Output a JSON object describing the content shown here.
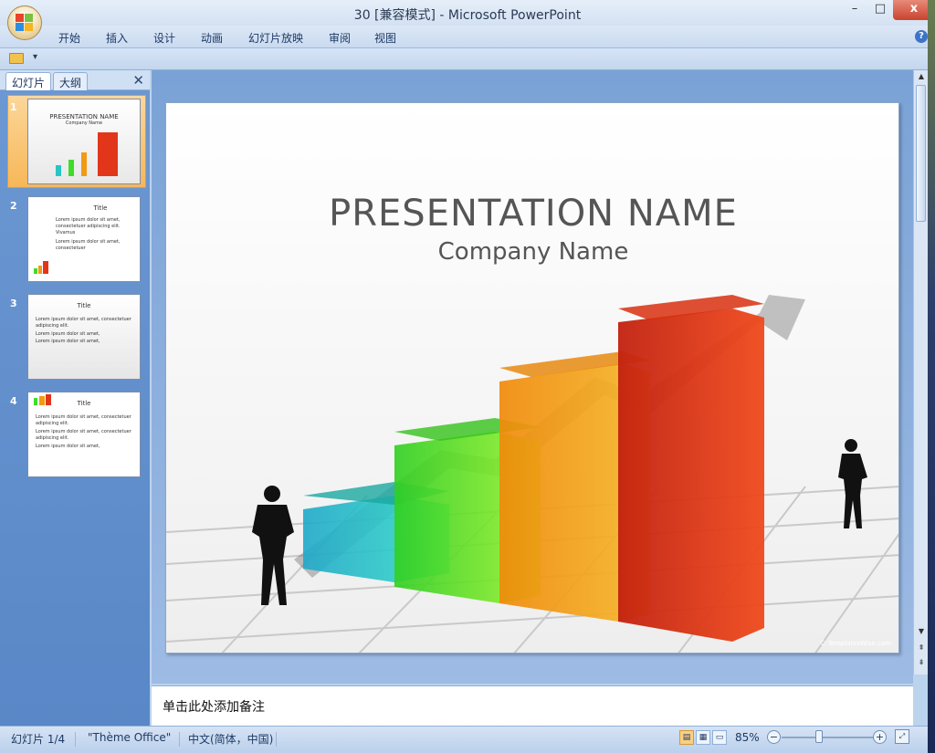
{
  "window": {
    "title": "30 [兼容模式] - Microsoft PowerPoint",
    "minimize": "–",
    "maximize": "□",
    "close": "x"
  },
  "ribbon": {
    "tabs": [
      "开始",
      "插入",
      "设计",
      "动画",
      "幻灯片放映",
      "审阅",
      "视图"
    ],
    "help": "?"
  },
  "left_pane": {
    "tabs": [
      "幻灯片",
      "大纲"
    ],
    "close": "✕",
    "thumbnails": [
      {
        "num": "1",
        "title": "PRESENTATION NAME",
        "subtitle": "Company Name",
        "selected": true
      },
      {
        "num": "2",
        "title": "Title",
        "bullets": [
          "Lorem ipsum dolor sit amet, consectetuer adipiscing elit. Vivamus",
          "Lorem ipsum dolor sit amet, consectetuer"
        ]
      },
      {
        "num": "3",
        "title": "Title",
        "bullets": [
          "Lorem ipsum dolor sit amet, consectetuer adipiscing elit.",
          "Lorem ipsum dolor sit amet,",
          "Lorem ipsum dolor sit amet,"
        ]
      },
      {
        "num": "4",
        "title": "Title",
        "bullets": [
          "Lorem ipsum dolor sit amet, consectetuer adipiscing elit.",
          "Lorem ipsum dolor sit amet, consectetuer adipiscing elit.",
          "Lorem ipsum dolor sit amet,"
        ]
      }
    ]
  },
  "slide": {
    "title": "PRESENTATION  NAME",
    "subtitle": "Company Name",
    "credit": "© TemplatesWise.com",
    "bar_colors": [
      "#27c6c6",
      "#3fdc2a",
      "#f29a14",
      "#e2361a"
    ]
  },
  "notes": {
    "placeholder": "单击此处添加备注"
  },
  "statusbar": {
    "slide_counter": "幻灯片 1/4",
    "theme": "\"Thème Office\"",
    "language": "中文(简体，中国)",
    "zoom": "85%"
  }
}
